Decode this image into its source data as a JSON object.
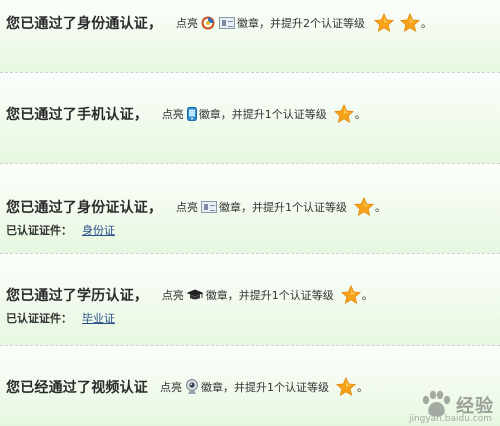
{
  "cards": [
    {
      "title": "您已通过了身份通认证",
      "comma": "，",
      "light": "点亮",
      "suffix": "徽章，并提升2个认证等级",
      "period": "。"
    },
    {
      "title": "您已通过了手机认证",
      "comma": "，",
      "light": "点亮",
      "suffix": "徽章，并提升1个认证等级",
      "period": "。"
    },
    {
      "title": "您已通过了身份证认证",
      "comma": "，",
      "light": "点亮",
      "suffix": "徽章，并提升1个认证等级",
      "period": "。",
      "cert_label": "已认证证件：",
      "cert_value": "身份证"
    },
    {
      "title": "您已通过了学历认证",
      "comma": "，",
      "light": "点亮",
      "suffix": "徽章，并提升1个认证等级",
      "period": "。",
      "cert_label": "已认证证件：",
      "cert_value": "毕业证"
    },
    {
      "title": "您已经通过了视频认证",
      "comma": "",
      "light": "点亮",
      "suffix": "徽章，并提升1个认证等级",
      "period": "。"
    }
  ],
  "icons": {
    "star": "star-icon",
    "id_card": "id-card-icon",
    "ring": "identity-ring-icon",
    "phone": "mobile-phone-icon",
    "cap": "graduation-cap-icon",
    "camera": "webcam-icon"
  },
  "colors": {
    "star": "#f7a21b",
    "card_bottom": "#e6f7df",
    "link": "#2a4f8a"
  },
  "watermark": {
    "text": "经验",
    "sub": "jingyan.baidu.com"
  }
}
